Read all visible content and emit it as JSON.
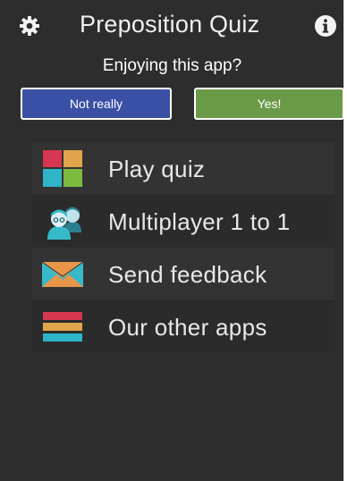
{
  "header": {
    "title": "Preposition Quiz",
    "settings_icon": "gear-icon",
    "info_icon": "info-icon"
  },
  "rating": {
    "prompt": "Enjoying this app?",
    "no_label": "Not really",
    "yes_label": "Yes!",
    "no_color": "#3a50a5",
    "yes_color": "#6a9a47"
  },
  "menu": {
    "items": [
      {
        "label": "Play quiz",
        "icon": "tiles-icon"
      },
      {
        "label": "Multiplayer 1 to 1",
        "icon": "multiplayer-icon"
      },
      {
        "label": "Send feedback",
        "icon": "envelope-icon"
      },
      {
        "label": "Our other apps",
        "icon": "stacked-bars-icon"
      }
    ]
  },
  "colors": {
    "background": "#2d2d2d",
    "tile_red": "#d6364f",
    "tile_orange": "#e0a44a",
    "tile_teal": "#2fb5c7",
    "tile_green": "#7dbb3e",
    "envelope_teal": "#38b9c9",
    "envelope_orange": "#e8974a"
  }
}
